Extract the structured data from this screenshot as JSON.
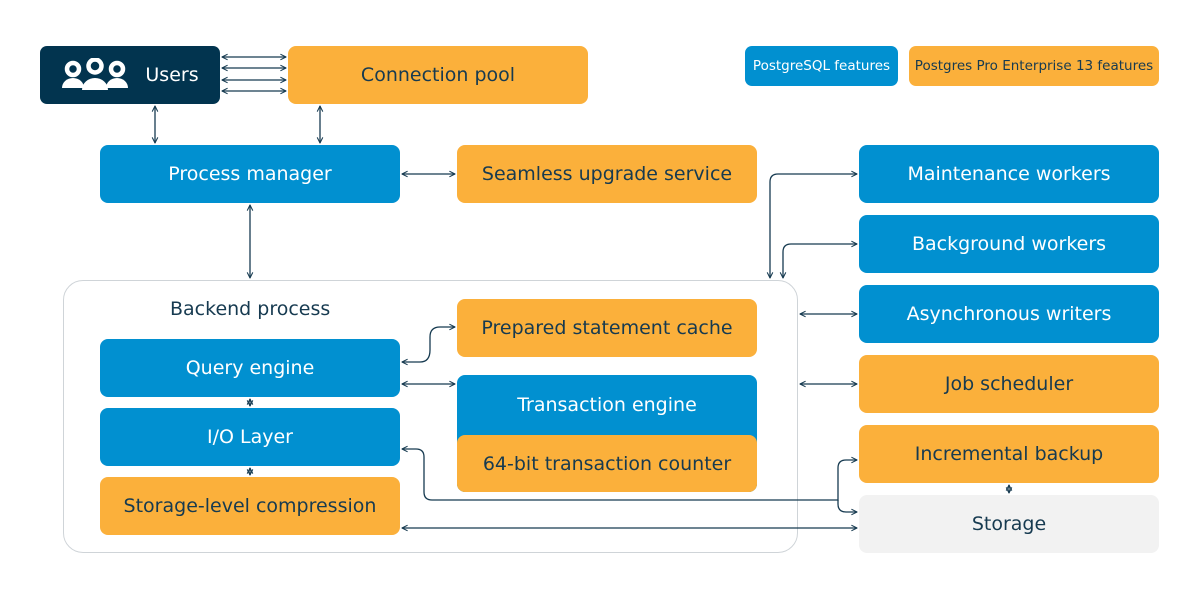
{
  "colors": {
    "postgresql": "#0190d0",
    "enterprise": "#fbb03b",
    "users": "#02344f",
    "storage": "#f2f2f2",
    "arrow": "#163a50"
  },
  "legend": {
    "postgresql": "PostgreSQL features",
    "enterprise": "Postgres Pro Enterprise 13 features"
  },
  "users": {
    "label": "Users",
    "icon": "users-icon"
  },
  "connection_pool": "Connection pool",
  "process_manager": "Process manager",
  "seamless_upgrade": "Seamless upgrade service",
  "backend": {
    "title": "Backend process",
    "query_engine": "Query engine",
    "io_layer": "I/O Layer",
    "compression": "Storage-level compression",
    "prepared_cache": "Prepared statement cache",
    "transaction_engine": "Transaction engine",
    "counter": "64-bit transaction counter"
  },
  "right": {
    "maintenance": "Maintenance workers",
    "background": "Background workers",
    "async_writers": "Asynchronous writers",
    "job_scheduler": "Job scheduler",
    "incremental_backup": "Incremental backup",
    "storage": "Storage"
  }
}
